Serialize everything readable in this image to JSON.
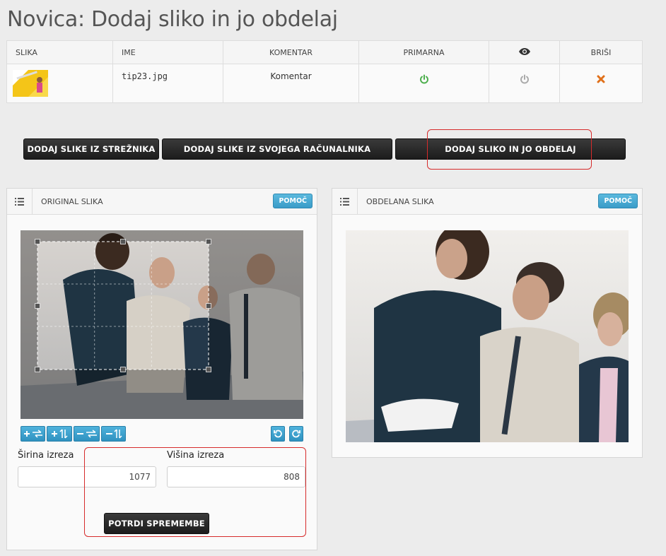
{
  "page": {
    "title": "Novica: Dodaj sliko in jo obdelaj"
  },
  "table": {
    "headers": {
      "slika": "SLIKA",
      "ime": "IME",
      "komentar": "KOMENTAR",
      "primarna": "PRIMARNA",
      "brisi": "BRIŠI"
    },
    "rows": [
      {
        "ime": "tip23.jpg",
        "komentar": "Komentar"
      }
    ]
  },
  "buttons": {
    "from_server": "DODAJ SLIKE IZ STREŽNIKA",
    "from_computer": "DODAJ SLIKE IZ SVOJEGA RAČUNALNIKA",
    "add_and_edit": "DODAJ SLIKO IN JO OBDELAJ"
  },
  "original_panel": {
    "title": "ORIGINAL SLIKA",
    "help": "POMOČ",
    "width_label": "Širina izreza",
    "width_value": "1077",
    "height_label": "Višina izreza",
    "height_value": "808",
    "confirm": "POTRDI SPREMEMBE"
  },
  "edited_panel": {
    "title": "OBDELANA SLIKA",
    "help": "POMOČ"
  },
  "colors": {
    "accent": "#3a9cc8",
    "power_on": "#4cae4c",
    "power_off": "#aaaaaa",
    "delete": "#e0701a",
    "highlight": "#d62b2b"
  }
}
